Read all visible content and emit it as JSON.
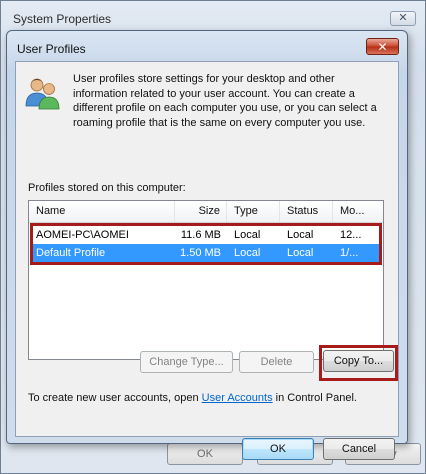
{
  "outer_window": {
    "title": "System Properties",
    "close_glyph": "✕",
    "footer_buttons": [
      "OK",
      "Cancel",
      "Apply"
    ]
  },
  "dialog": {
    "title": "User Profiles",
    "close_glyph": "✕",
    "icon": "users-icon",
    "description": "User profiles store settings for your desktop and other information related to your user account. You can create a different profile on each computer you use, or you can select a roaming profile that is the same on every computer you use.",
    "profiles_label": "Profiles stored on this computer:",
    "columns": [
      "Name",
      "Size",
      "Type",
      "Status",
      "Mo..."
    ],
    "rows": [
      {
        "name": "AOMEI-PC\\AOMEI",
        "size": "11.6 MB",
        "type": "Local",
        "status": "Local",
        "modified": "12...",
        "selected": false
      },
      {
        "name": "Default Profile",
        "size": "1.50 MB",
        "type": "Local",
        "status": "Local",
        "modified": "1/...",
        "selected": true
      }
    ],
    "buttons": {
      "change_type": "Change Type...",
      "delete": "Delete",
      "copy_to": "Copy To..."
    },
    "footer_text": {
      "before": "To create new user accounts, open ",
      "link": "User Accounts",
      "after": " in Control Panel."
    },
    "ok": "OK",
    "cancel": "Cancel"
  },
  "colors": {
    "selection": "#3399ff",
    "annotation": "#a61c1c",
    "link": "#0066cc"
  }
}
